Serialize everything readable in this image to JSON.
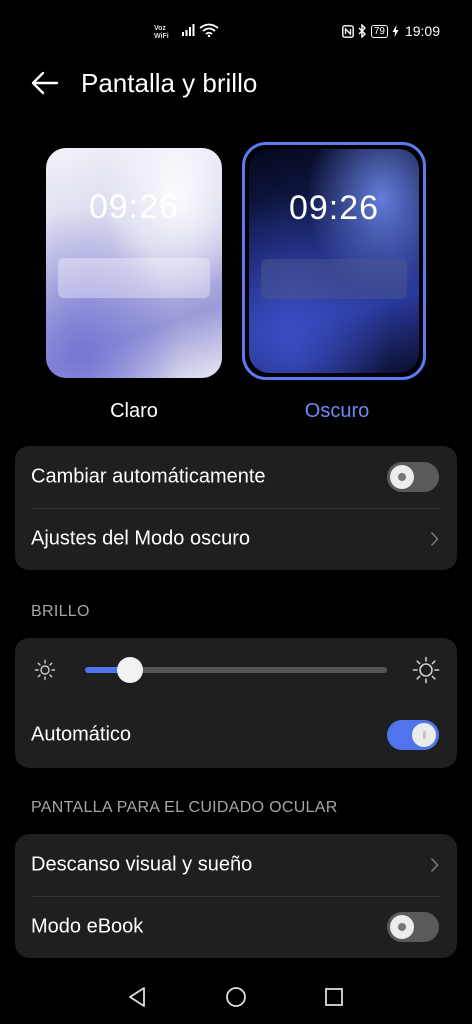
{
  "status_bar": {
    "carrier_top": "Voz",
    "carrier_bottom": "WiFi",
    "battery": "79",
    "time": "19:09",
    "icons": [
      "signal-icon",
      "wifi-icon",
      "nfc-icon",
      "bluetooth-icon",
      "battery-icon",
      "charging-icon"
    ]
  },
  "header": {
    "title": "Pantalla y brillo",
    "back_icon": "back-arrow-icon"
  },
  "themes": {
    "claro": {
      "time": "09:26",
      "label": "Claro",
      "selected": false
    },
    "oscuro": {
      "time": "09:26",
      "label": "Oscuro",
      "selected": true
    },
    "accent": "#6e8af5"
  },
  "dark_mode_card": {
    "auto_switch_label": "Cambiar automáticamente",
    "auto_switch_on": false,
    "settings_label": "Ajustes del Modo oscuro"
  },
  "brightness": {
    "section_title": "BRILLO",
    "level": 0.15,
    "auto_label": "Automático",
    "auto_on": true
  },
  "eye_care": {
    "section_title": "PANTALLA PARA EL CUIDADO OCULAR",
    "rest_label": "Descanso visual y sueño",
    "ebook_label": "Modo eBook",
    "ebook_on": false
  },
  "colors": {
    "accent": "#4f74ec",
    "card": "#1f1f1f",
    "background": "#000000"
  }
}
